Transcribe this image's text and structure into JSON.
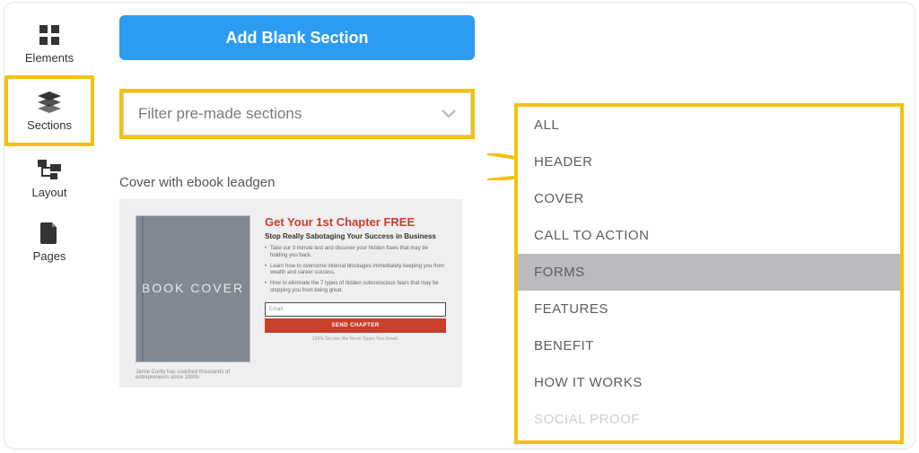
{
  "sidebar": {
    "items": [
      {
        "label": "Elements"
      },
      {
        "label": "Sections"
      },
      {
        "label": "Layout"
      },
      {
        "label": "Pages"
      }
    ]
  },
  "toolbar": {
    "add_blank_label": "Add Blank Section"
  },
  "filter": {
    "placeholder": "Filter pre-made sections",
    "options": [
      "ALL",
      "HEADER",
      "COVER",
      "CALL TO ACTION",
      "FORMS",
      "FEATURES",
      "BENEFIT",
      "HOW IT WORKS",
      "SOCIAL PROOF"
    ],
    "active_index": 4
  },
  "section": {
    "title": "Cover with ebook leadgen",
    "preview": {
      "book_text": "BOOK COVER",
      "headline": "Get Your 1st Chapter FREE",
      "sub": "Stop Really Sabotaging Your Success in Business",
      "bullets": [
        "Take our 3 minute test and discover your hidden flaws that may be holding you back.",
        "Learn how to overcome internal blockages immediately keeping you from wealth and career success.",
        "How to eliminate the 7 types of hidden subconscious fears that may be stopping you from being great."
      ],
      "email_placeholder": "Email",
      "cta": "SEND CHAPTER",
      "secure": "100% Secure. We Never Spam Your Email.",
      "author_note": "Jamie Curtly has coached thousands of entrepreneurs since 1990s"
    }
  },
  "colors": {
    "highlight": "#f4c20d",
    "primary": "#2b9cf2",
    "accent_red": "#c7402a"
  }
}
